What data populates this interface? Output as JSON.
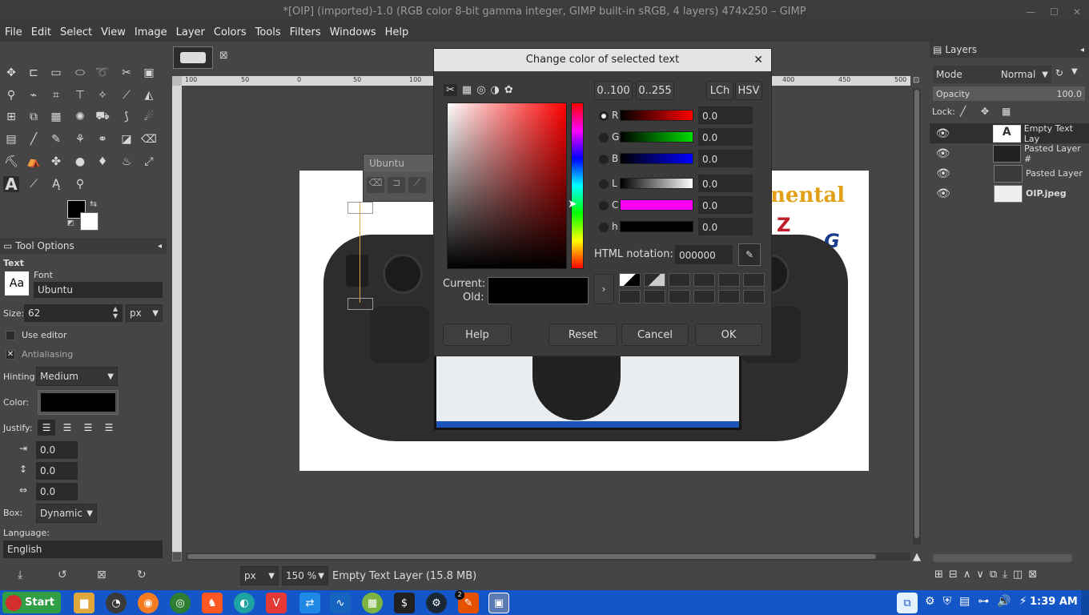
{
  "window": {
    "title": "*[OIP] (imported)-1.0 (RGB color 8-bit gamma integer, GIMP built-in sRGB, 4 layers) 474x250 – GIMP"
  },
  "menu": [
    "File",
    "Edit",
    "Select",
    "View",
    "Image",
    "Layer",
    "Colors",
    "Tools",
    "Filters",
    "Windows",
    "Help"
  ],
  "tool_options": {
    "tab_label": "Tool Options",
    "section": "Text",
    "font_label": "Font",
    "font_value": "Ubuntu",
    "size_label": "Size:",
    "size_value": "62",
    "size_unit": "px",
    "use_editor": "Use editor",
    "antialiasing": "Antialiasing",
    "hinting_label": "Hinting:",
    "hinting_value": "Medium",
    "color_label": "Color:",
    "justify_label": "Justify:",
    "indent_value": "0.0",
    "line_spacing_value": "0.0",
    "letter_spacing_value": "0.0",
    "box_label": "Box:",
    "box_value": "Dynamic",
    "language_label": "Language:",
    "language_value": "English",
    "font_preview": "Aa"
  },
  "canvas": {
    "ruler_labels": [
      "100",
      "50",
      "0",
      "50",
      "100",
      "150",
      "200",
      "250",
      "300",
      "350",
      "400",
      "450",
      "500"
    ],
    "text_toolbox_font": "Ubuntu",
    "status_unit": "px",
    "status_zoom": "150 %",
    "status_text": "Empty Text Layer (15.8 MB)"
  },
  "dialog": {
    "title": "Change color of selected text",
    "range_buttons": [
      "0..100",
      "0..255"
    ],
    "model_buttons": [
      "LCh",
      "HSV"
    ],
    "channels": [
      {
        "label": "R",
        "value": "0.0"
      },
      {
        "label": "G",
        "value": "0.0"
      },
      {
        "label": "B",
        "value": "0.0"
      },
      {
        "label": "L",
        "value": "0.0"
      },
      {
        "label": "C",
        "value": "0.0"
      },
      {
        "label": "h",
        "value": "0.0"
      }
    ],
    "html_notation_label": "HTML notation:",
    "html_notation_value": "000000",
    "current_label": "Current:",
    "old_label": "Old:",
    "buttons": {
      "help": "Help",
      "reset": "Reset",
      "cancel": "Cancel",
      "ok": "OK"
    }
  },
  "layers": {
    "tab_label": "Layers",
    "mode_label": "Mode",
    "mode_value": "Normal",
    "opacity_label": "Opacity",
    "opacity_value": "100.0",
    "lock_label": "Lock:",
    "items": [
      {
        "name": "Empty Text Lay"
      },
      {
        "name": "Pasted Layer #"
      },
      {
        "name": "Pasted Layer"
      },
      {
        "name": "OIP.jpeg"
      }
    ]
  },
  "taskbar": {
    "start_label": "Start",
    "time": "1:39 AM",
    "badge": "2"
  },
  "colors": {
    "accent": "#1456c8",
    "panel": "#454545"
  }
}
